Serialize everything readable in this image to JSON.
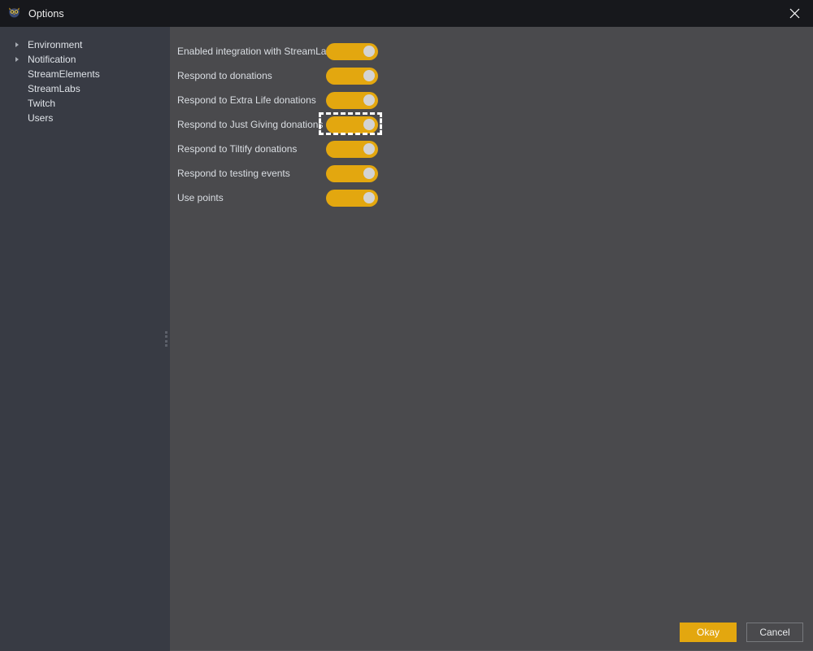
{
  "window": {
    "title": "Options",
    "app_icon": "owl-icon",
    "close_icon": "close-icon"
  },
  "sidebar": {
    "items": [
      {
        "label": "Environment",
        "expandable": true,
        "indent": 0
      },
      {
        "label": "Notification",
        "expandable": true,
        "indent": 0
      },
      {
        "label": "StreamElements",
        "expandable": false,
        "indent": 1
      },
      {
        "label": "StreamLabs",
        "expandable": false,
        "indent": 1
      },
      {
        "label": "Twitch",
        "expandable": false,
        "indent": 1
      },
      {
        "label": "Users",
        "expandable": false,
        "indent": 1
      }
    ],
    "splitter": "vertical-splitter"
  },
  "options": [
    {
      "label": "Enabled integration with StreamLabs",
      "state": "on",
      "focused": false
    },
    {
      "label": "Respond to donations",
      "state": "on",
      "focused": false
    },
    {
      "label": "Respond to Extra Life donations",
      "state": "on",
      "focused": false
    },
    {
      "label": "Respond to Just Giving donations",
      "state": "on",
      "focused": true
    },
    {
      "label": "Respond to Tiltify donations",
      "state": "on",
      "focused": false
    },
    {
      "label": "Respond to testing events",
      "state": "on",
      "focused": false
    },
    {
      "label": "Use points",
      "state": "on",
      "focused": false
    }
  ],
  "footer": {
    "okay_label": "Okay",
    "cancel_label": "Cancel"
  },
  "colors": {
    "accent": "#e3a70f",
    "titlebar_bg": "#17181c",
    "sidebar_bg": "#383b44",
    "content_bg": "#4a4a4d",
    "text": "#dadee3",
    "focus_ring": "#ffffff"
  }
}
